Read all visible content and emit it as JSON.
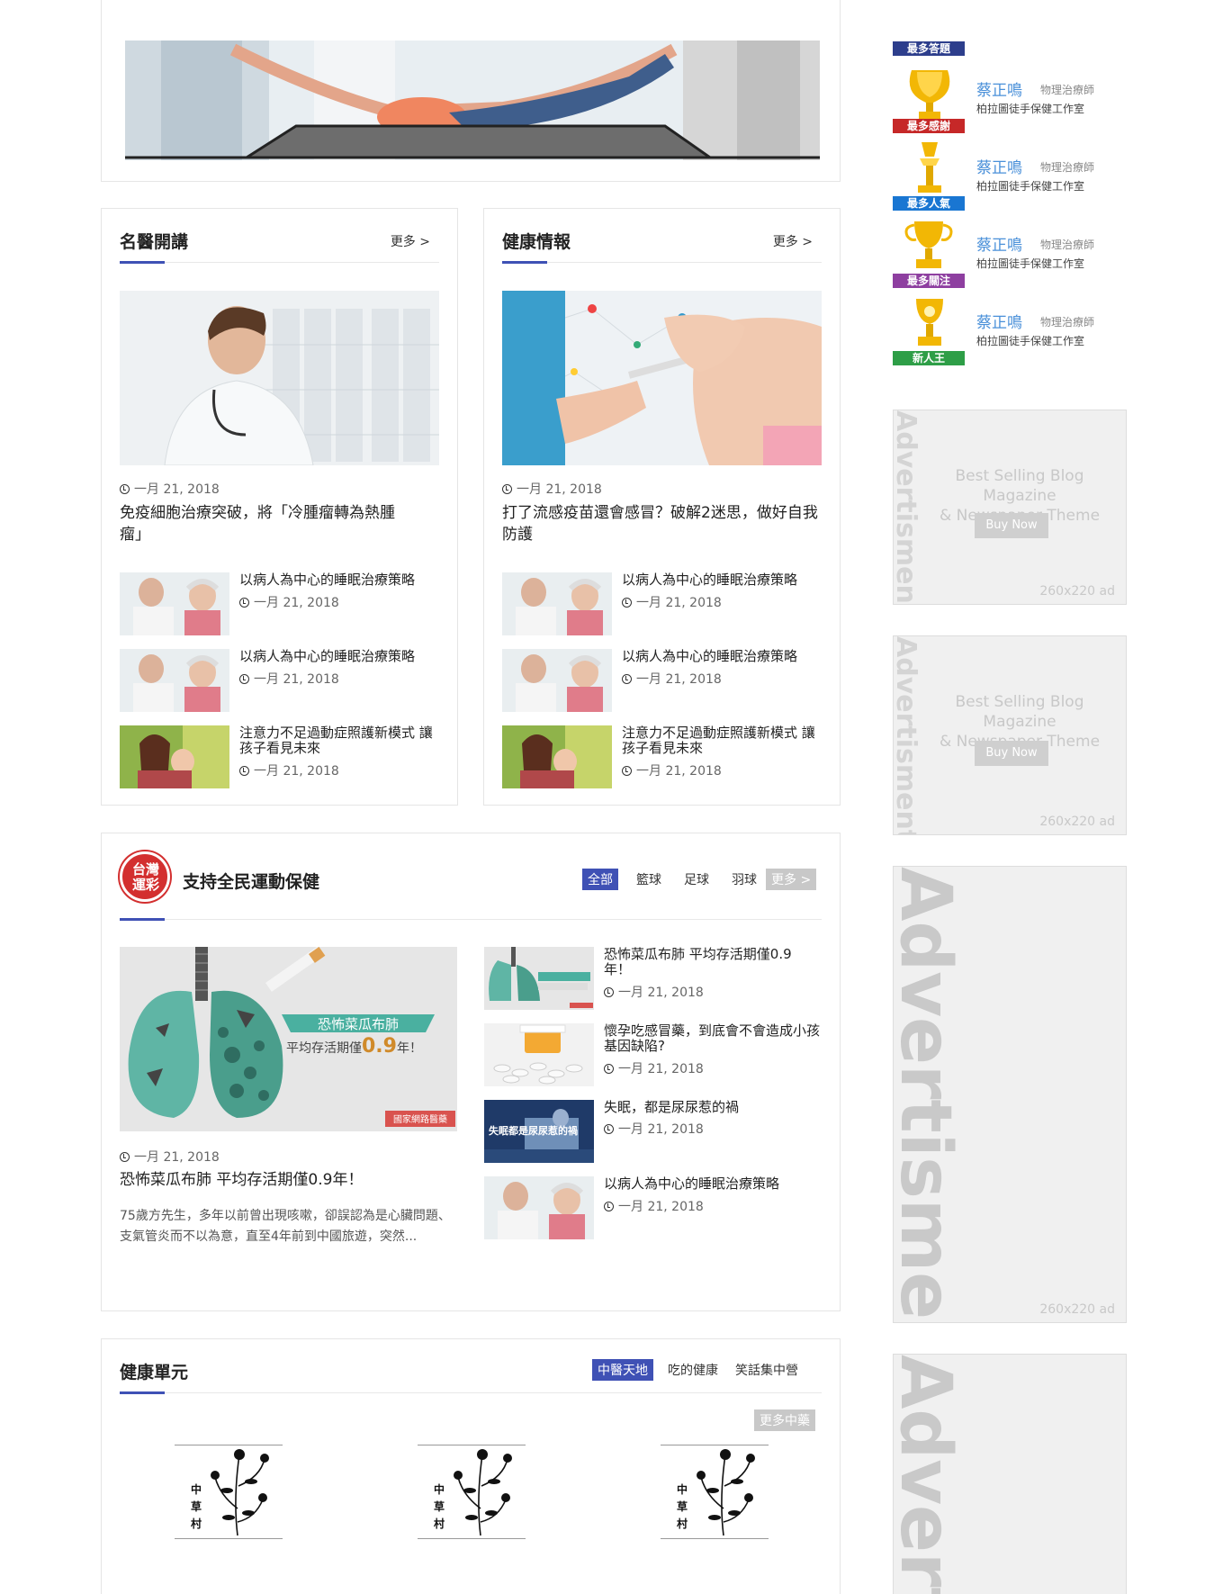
{
  "top_panel": {
    "image_alt": "pilates-exercise-photo"
  },
  "doctor_section": {
    "title": "名醫開講",
    "more": "更多 >",
    "feature": {
      "date": "一月 21, 2018",
      "title": "免疫細胞治療突破，將「冷腫瘤轉為熱腫瘤」"
    },
    "items": [
      {
        "title": "以病人為中心的睡眠治療策略",
        "date": "一月 21, 2018"
      },
      {
        "title": "以病人為中心的睡眠治療策略",
        "date": "一月 21, 2018"
      },
      {
        "title": "注意力不足過動症照護新模式 讓孩子看見未來",
        "date": "一月 21, 2018"
      }
    ]
  },
  "health_info_section": {
    "title": "健康情報",
    "more": "更多 >",
    "feature": {
      "date": "一月 21, 2018",
      "title": "打了流感疫苗還會感冒？破解2迷思，做好自我防護"
    },
    "items": [
      {
        "title": "以病人為中心的睡眠治療策略",
        "date": "一月 21, 2018"
      },
      {
        "title": "以病人為中心的睡眠治療策略",
        "date": "一月 21, 2018"
      },
      {
        "title": "注意力不足過動症照護新模式 讓孩子看見未來",
        "date": "一月 21, 2018"
      }
    ]
  },
  "sports_section": {
    "logo_text": "台灣運彩",
    "title": "支持全民運動保健",
    "tabs": [
      "全部",
      "籃球",
      "足球",
      "羽球"
    ],
    "more": "更多 >",
    "feature": {
      "image_title": "恐怖菜瓜布肺",
      "image_sub_prefix": "平均存活期僅",
      "image_sub_value": "0.9",
      "image_sub_suffix": "年！",
      "image_tag": "國家網路醫藥",
      "date": "一月 21, 2018",
      "title": "恐怖菜瓜布肺 平均存活期僅0.9年！",
      "excerpt": "75歲方先生，多年以前曾出現咳嗽，卻誤認為是心臟問題、支氣管炎而不以為意，直至4年前到中國旅遊，突然..."
    },
    "items": [
      {
        "title": "恐怖菜瓜布肺 平均存活期僅0.9年！",
        "date": "一月 21, 2018"
      },
      {
        "title": "懷孕吃感冒藥，到底會不會造成小孩基因缺陷?",
        "date": "一月 21, 2018"
      },
      {
        "title": "失眠，都是尿尿惹的禍",
        "date": "一月 21, 2018",
        "thumb_text": "失眠都是尿尿惹的禍"
      },
      {
        "title": "以病人為中心的睡眠治療策略",
        "date": "一月 21, 2018"
      }
    ]
  },
  "health_unit_section": {
    "title": "健康單元",
    "tabs": [
      "中醫天地",
      "吃的健康",
      "笑話集中營"
    ],
    "more": "更多中藥",
    "herb_label": [
      "中",
      "草",
      "村"
    ]
  },
  "ranking": [
    {
      "label": "最多答題",
      "color": "#2d3e8c"
    },
    {
      "label": "最多感謝",
      "color": "#c62828",
      "name": "蔡正鳴",
      "role": "物理治療師",
      "org": "柏拉圖徒手保健工作室"
    },
    {
      "label": "最多人氣",
      "color": "#1976d2",
      "name": "蔡正鳴",
      "role": "物理治療師",
      "org": "柏拉圖徒手保健工作室"
    },
    {
      "label": "最多關注",
      "color": "#8e3fa0",
      "name": "蔡正鳴",
      "role": "物理治療師",
      "org": "柏拉圖徒手保健工作室"
    },
    {
      "label": "新人王",
      "color": "#2e9e47",
      "name": "蔡正鳴",
      "role": "物理治療師",
      "org": "柏拉圖徒手保健工作室"
    }
  ],
  "ads": [
    {
      "vert": "Advertisment",
      "line1": "Best Selling Blog Magazine",
      "line2": "& Newspaper Theme",
      "button": "Buy Now",
      "size": "260x220 ad"
    },
    {
      "vert": "Advertisment",
      "line1": "Best Selling Blog Magazine",
      "line2": "& Newspaper Theme",
      "button": "Buy Now",
      "size": "260x220 ad"
    },
    {
      "vert": "Advertisment",
      "size": "260x220 ad"
    },
    {
      "vert": "Advert"
    }
  ]
}
